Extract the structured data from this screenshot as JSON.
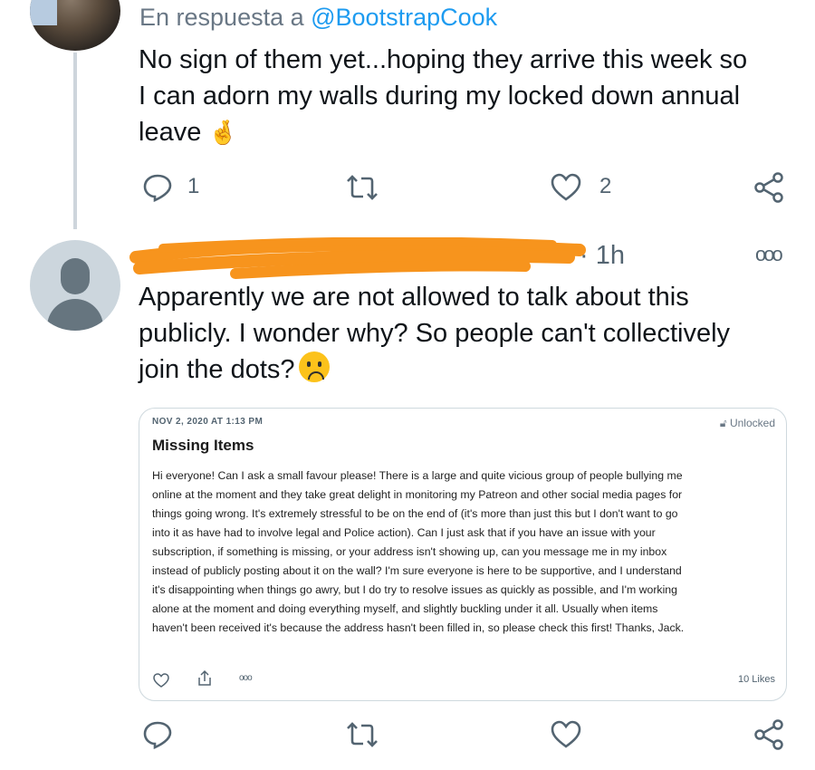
{
  "tweet1": {
    "reply_prefix": "En respuesta a ",
    "reply_handle": "@BootstrapCook",
    "line1": "No sign of them yet...hoping they arrive this week so",
    "line2": "I can adorn my walls during my locked down annual",
    "line3": "leave",
    "emoji": "🤞",
    "reply_count": "1",
    "like_count": "2"
  },
  "tweet2": {
    "time": "· 1h",
    "more": "ooo",
    "line1": "Apparently we are not allowed to talk about this",
    "line2": "publicly. I wonder why? So people can't collectively",
    "line3": "join the dots?",
    "embed": {
      "date": "NOV 2, 2020 AT 1:13 PM",
      "lock_label": "Unlocked",
      "title": "Missing Items",
      "body_lines": [
        "Hi everyone! Can I ask a small favour please! There is a large and quite vicious group of people bullying me",
        "online at the moment and they take great delight in monitoring my Patreon and other social media pages for",
        "things going wrong. It's extremely stressful to be on the end of (it's more than just this but I don't want to go",
        "into it as have had to involve legal and Police action). Can I just ask that if you have an issue with your",
        "subscription, if something is missing, or your address isn't showing up, can you message me in my inbox",
        "instead of publicly posting about it on the wall? I'm sure everyone is here to be supportive, and I understand",
        "it's disappointing when things go awry, but I do try to resolve issues as quickly as possible, and I'm working",
        "alone at the moment and doing everything myself, and slightly buckling under it all. Usually when items",
        "haven't been received it's because the address hasn't been filled in, so please check this first!  Thanks, Jack."
      ],
      "more": "ooo",
      "likes": "10 Likes"
    }
  },
  "colors": {
    "accent": "#1d9bf0",
    "redaction": "#f7941d"
  }
}
